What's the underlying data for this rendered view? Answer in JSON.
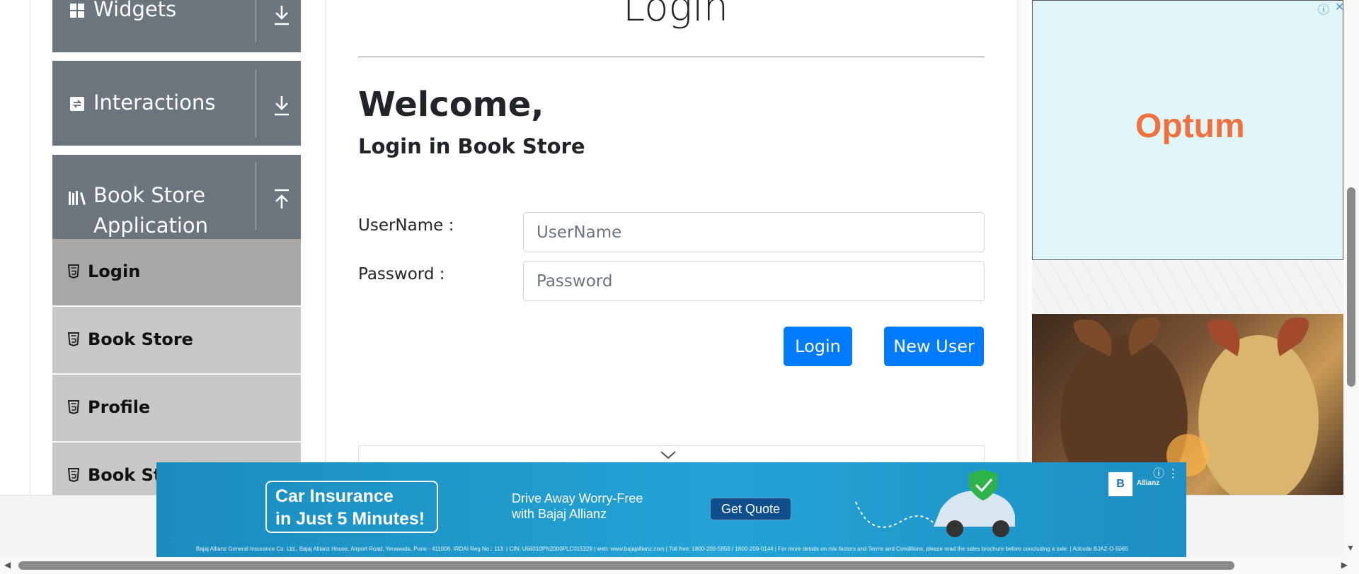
{
  "sidebar": {
    "groups": [
      {
        "label": "Widgets",
        "icon": "grid-icon",
        "toggle": "download-arrow-icon"
      },
      {
        "label": "Interactions",
        "icon": "interactions-icon",
        "toggle": "download-arrow-icon"
      },
      {
        "label": "Book Store Application",
        "icon": "books-icon",
        "toggle": "upload-arrow-icon"
      }
    ],
    "items": [
      {
        "label": "Login",
        "active": true
      },
      {
        "label": "Book Store",
        "active": false
      },
      {
        "label": "Profile",
        "active": false
      },
      {
        "label": "Book Sto",
        "active": false
      }
    ]
  },
  "main": {
    "title": "Login",
    "welcome": "Welcome,",
    "subtitle": "Login in Book Store",
    "username_label": "UserName :",
    "username_placeholder": "UserName",
    "password_label": "Password :",
    "password_placeholder": "Password",
    "login_button": "Login",
    "new_user_button": "New User"
  },
  "ads": {
    "top_brand": "Optum",
    "banner": {
      "headline_line1": "Car Insurance",
      "headline_line2": "in Just 5 Minutes!",
      "tagline_line1": "Drive Away Worry-Free",
      "tagline_line2": "with Bajaj Allianz",
      "cta": "Get Quote",
      "logo_text": "Allianz",
      "fine_print": "Bajaj Allianz General Insurance Co. Ltd., Bajaj Allianz House, Airport Road, Yerawada, Pune - 411006. IRDAI Reg No.: 113. | CIN: U66010PN2000PLC015329 | web: www.bajajallianz.com | Toll free: 1800-209-5858 / 1800-209-0144 | For more details on risk factors and Terms and Conditions, please read the sales brochure before concluding a sale. | Adcode BJAZ-O-5065"
    }
  },
  "colors": {
    "primary": "#007bff",
    "sidebar_header": "#6c757d",
    "menu_item": "#c8c8c8",
    "menu_active": "#a8a8a8",
    "ad_brand": "#f0703e"
  }
}
